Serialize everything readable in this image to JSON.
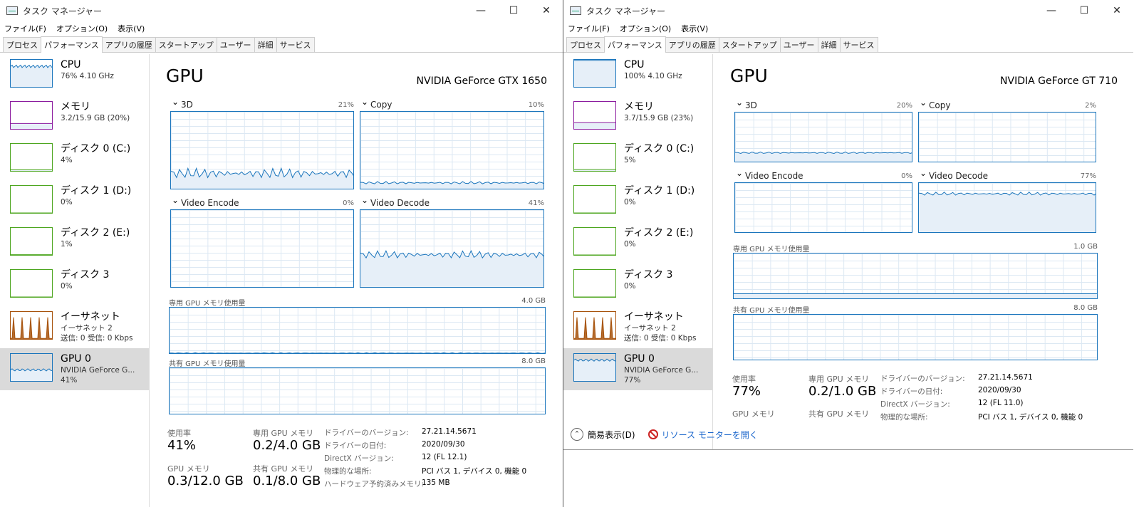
{
  "windows": [
    {
      "id": "left",
      "title": "タスク マネージャー",
      "controls": {
        "minimize": "—",
        "maximize": "☐",
        "close": "✕"
      },
      "menu": [
        "ファイル(F)",
        "オプション(O)",
        "表示(V)"
      ],
      "tabs": [
        "プロセス",
        "パフォーマンス",
        "アプリの履歴",
        "スタートアップ",
        "ユーザー",
        "詳細",
        "サービス"
      ],
      "active_tab": "パフォーマンス",
      "sidebar": [
        {
          "name": "CPU",
          "sub": "76%  4.10 GHz",
          "sub2": "",
          "color": "#1a75bc"
        },
        {
          "name": "メモリ",
          "sub": "3.2/15.9 GB (20%)",
          "sub2": "",
          "color": "#8b1a9e"
        },
        {
          "name": "ディスク 0 (C:)",
          "sub": "4%",
          "sub2": "",
          "color": "#4da61f"
        },
        {
          "name": "ディスク 1 (D:)",
          "sub": "0%",
          "sub2": "",
          "color": "#4da61f"
        },
        {
          "name": "ディスク 2 (E:)",
          "sub": "1%",
          "sub2": "",
          "color": "#4da61f"
        },
        {
          "name": "ディスク 3",
          "sub": "0%",
          "sub2": "",
          "color": "#4da61f"
        },
        {
          "name": "イーサネット",
          "sub": "イーサネット 2",
          "sub2": "送信: 0  受信: 0 Kbps",
          "color": "#a7520b"
        },
        {
          "name": "GPU 0",
          "sub": "NVIDIA GeForce G...",
          "sub2": "41%",
          "color": "#1a75bc"
        }
      ],
      "title_main": "GPU",
      "gpu_name": "NVIDIA GeForce GTX 1650",
      "engines": [
        {
          "label": "3D",
          "pct": "21%"
        },
        {
          "label": "Copy",
          "pct": "10%"
        },
        {
          "label": "Video Encode",
          "pct": "0%"
        },
        {
          "label": "Video Decode",
          "pct": "41%"
        }
      ],
      "dedicated_label": "専用 GPU メモリ使用量",
      "dedicated_max": "4.0 GB",
      "shared_label": "共有 GPU メモリ使用量",
      "shared_max": "8.0 GB",
      "stats": [
        {
          "label": "使用率",
          "value": "41%"
        },
        {
          "label": "専用 GPU メモリ",
          "value": "0.2/4.0 GB"
        },
        {
          "label": "GPU メモリ",
          "value": "0.3/12.0 GB"
        },
        {
          "label": "共有 GPU メモリ",
          "value": "0.1/8.0 GB"
        }
      ],
      "details": [
        {
          "k": "ドライバーのバージョン:",
          "v": "27.21.14.5671"
        },
        {
          "k": "ドライバーの日付:",
          "v": "2020/09/30"
        },
        {
          "k": "DirectX バージョン:",
          "v": "12 (FL 12.1)"
        },
        {
          "k": "物理的な場所:",
          "v": "PCI バス 1, デバイス 0, 機能 0"
        },
        {
          "k": "ハードウェア予約済みメモリ:",
          "v": "135 MB"
        }
      ]
    },
    {
      "id": "right",
      "title": "タスク マネージャー",
      "controls": {
        "minimize": "—",
        "maximize": "☐",
        "close": "✕"
      },
      "menu": [
        "ファイル(F)",
        "オプション(O)",
        "表示(V)"
      ],
      "tabs": [
        "プロセス",
        "パフォーマンス",
        "アプリの履歴",
        "スタートアップ",
        "ユーザー",
        "詳細",
        "サービス"
      ],
      "active_tab": "パフォーマンス",
      "sidebar": [
        {
          "name": "CPU",
          "sub": "100%  4.10 GHz",
          "sub2": "",
          "color": "#1a75bc"
        },
        {
          "name": "メモリ",
          "sub": "3.7/15.9 GB (23%)",
          "sub2": "",
          "color": "#8b1a9e"
        },
        {
          "name": "ディスク 0 (C:)",
          "sub": "5%",
          "sub2": "",
          "color": "#4da61f"
        },
        {
          "name": "ディスク 1 (D:)",
          "sub": "0%",
          "sub2": "",
          "color": "#4da61f"
        },
        {
          "name": "ディスク 2 (E:)",
          "sub": "0%",
          "sub2": "",
          "color": "#4da61f"
        },
        {
          "name": "ディスク 3",
          "sub": "0%",
          "sub2": "",
          "color": "#4da61f"
        },
        {
          "name": "イーサネット",
          "sub": "イーサネット 2",
          "sub2": "送信: 0  受信: 0 Kbps",
          "color": "#a7520b"
        },
        {
          "name": "GPU 0",
          "sub": "NVIDIA GeForce G...",
          "sub2": "77%",
          "color": "#1a75bc"
        }
      ],
      "title_main": "GPU",
      "gpu_name": "NVIDIA GeForce GT 710",
      "engines": [
        {
          "label": "3D",
          "pct": "20%"
        },
        {
          "label": "Copy",
          "pct": "2%"
        },
        {
          "label": "Video Encode",
          "pct": "0%"
        },
        {
          "label": "Video Decode",
          "pct": "77%"
        }
      ],
      "dedicated_label": "専用 GPU メモリ使用量",
      "dedicated_max": "1.0 GB",
      "shared_label": "共有 GPU メモリ使用量",
      "shared_max": "8.0 GB",
      "stats": [
        {
          "label": "使用率",
          "value": "77%"
        },
        {
          "label": "専用 GPU メモリ",
          "value": "0.2/1.0 GB"
        },
        {
          "label": "GPU メモリ",
          "value": ""
        },
        {
          "label": "共有 GPU メモリ",
          "value": ""
        }
      ],
      "details": [
        {
          "k": "ドライバーのバージョン:",
          "v": "27.21.14.5671"
        },
        {
          "k": "ドライバーの日付:",
          "v": "2020/09/30"
        },
        {
          "k": "DirectX バージョン:",
          "v": "12 (FL 11.0)"
        },
        {
          "k": "物理的な場所:",
          "v": "PCI バス 1, デバイス 0, 機能 0"
        }
      ],
      "footer": {
        "simple_view": "簡易表示(D)",
        "resource_monitor": "リソース モニターを開く"
      }
    }
  ]
}
